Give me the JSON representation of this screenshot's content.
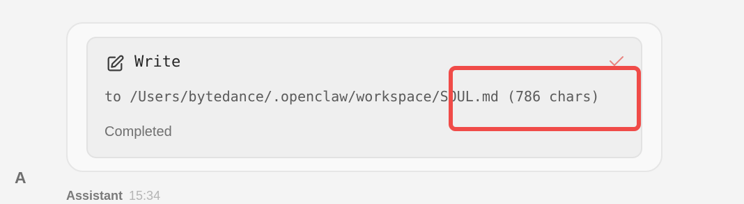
{
  "tool_call": {
    "name": "Write",
    "detail": "to /Users/bytedance/.openclaw/workspace/SOUL.md (786 chars)",
    "status": "Completed",
    "icon": "edit-icon",
    "status_icon": "check-icon"
  },
  "message_meta": {
    "avatar_initial": "A",
    "sender": "Assistant",
    "time": "15:34"
  },
  "colors": {
    "highlight": "#f04b48",
    "check": "#e9847f",
    "background": "#f4f4f4",
    "card": "#f9f9f9",
    "tool_card": "#efefef"
  }
}
